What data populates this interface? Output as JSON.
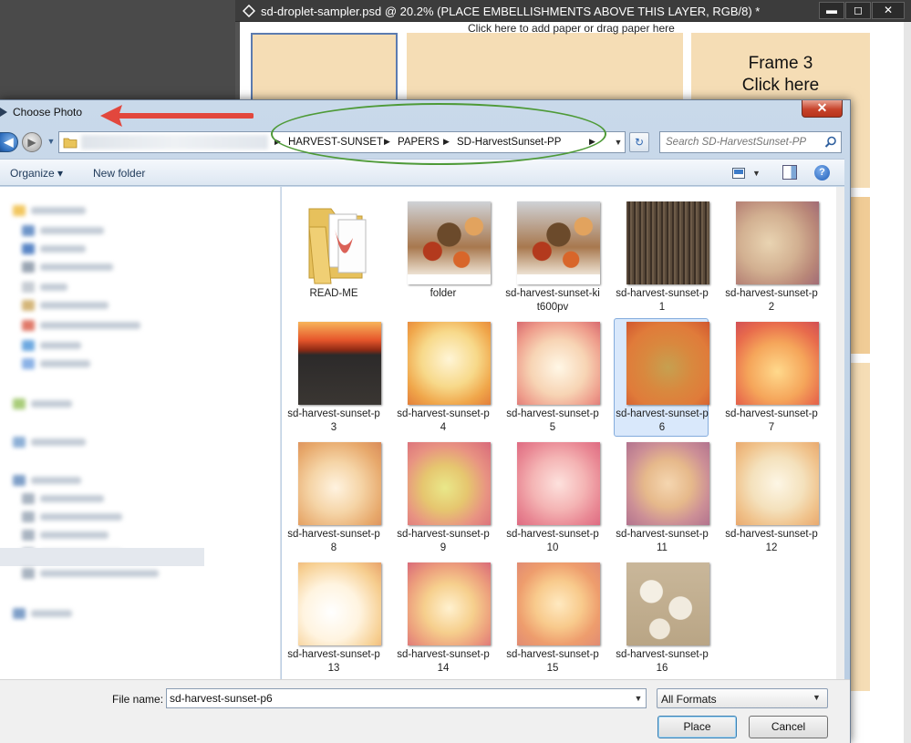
{
  "background_window": {
    "title": "sd-droplet-sampler.psd @ 20.2% (PLACE EMBELLISHMENTS ABOVE THIS LAYER, RGB/8) *",
    "canvas_hint": "Click here to add paper or drag paper here",
    "frame3_title": "Frame 3",
    "frame3_subtitle": "Click here",
    "controls": {
      "minimize": "▬",
      "maximize": "◻",
      "close": "✕"
    }
  },
  "dialog": {
    "title": "Choose Photo",
    "close_label": "✕",
    "breadcrumb": [
      "HARVEST-SUNSET",
      "PAPERS",
      "SD-HarvestSunset-PP"
    ],
    "search_placeholder": "Search SD-HarvestSunset-PP",
    "toolbar": {
      "organize": "Organize ▾",
      "new_folder": "New folder"
    },
    "files": [
      {
        "name": "READ-ME",
        "kind": "folder-icon"
      },
      {
        "name": "folder",
        "kind": "t-kit"
      },
      {
        "name": "sd-harvest-sunset-kit600pv",
        "kind": "t-kit"
      },
      {
        "name": "sd-harvest-sunset-p1",
        "kind": "t-p1"
      },
      {
        "name": "sd-harvest-sunset-p2",
        "kind": "t-p2"
      },
      {
        "name": "sd-harvest-sunset-p3",
        "kind": "t-p3"
      },
      {
        "name": "sd-harvest-sunset-p4",
        "kind": "t-p4"
      },
      {
        "name": "sd-harvest-sunset-p5",
        "kind": "t-p5"
      },
      {
        "name": "sd-harvest-sunset-p6",
        "kind": "t-p6",
        "selected": true
      },
      {
        "name": "sd-harvest-sunset-p7",
        "kind": "t-p7"
      },
      {
        "name": "sd-harvest-sunset-p8",
        "kind": "t-p8"
      },
      {
        "name": "sd-harvest-sunset-p9",
        "kind": "t-p9"
      },
      {
        "name": "sd-harvest-sunset-p10",
        "kind": "t-p10"
      },
      {
        "name": "sd-harvest-sunset-p11",
        "kind": "t-p11"
      },
      {
        "name": "sd-harvest-sunset-p12",
        "kind": "t-p12"
      },
      {
        "name": "sd-harvest-sunset-p13",
        "kind": "t-p13"
      },
      {
        "name": "sd-harvest-sunset-p14",
        "kind": "t-p14"
      },
      {
        "name": "sd-harvest-sunset-p15",
        "kind": "t-p15"
      },
      {
        "name": "sd-harvest-sunset-p16",
        "kind": "t-p16"
      }
    ],
    "footer": {
      "file_name_label": "File name:",
      "file_name_value": "sd-harvest-sunset-p6",
      "format_value": "All Formats",
      "place_label": "Place",
      "cancel_label": "Cancel"
    }
  },
  "annotations": {
    "arrow_color": "#e2473d",
    "ellipse_color": "#4e9a37"
  }
}
